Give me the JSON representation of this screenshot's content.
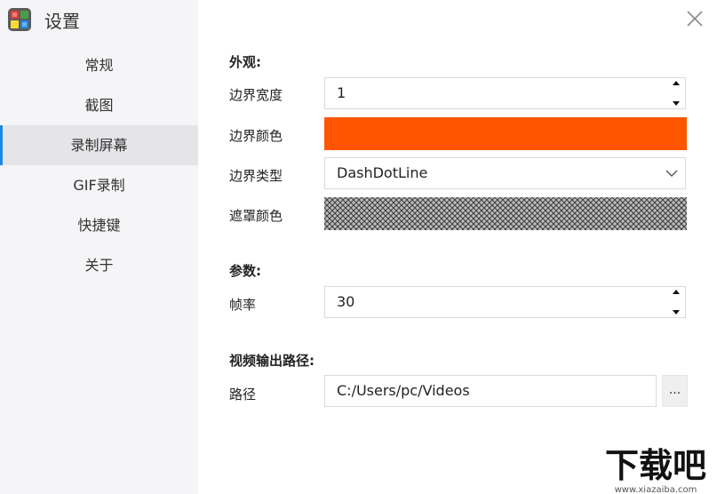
{
  "app": {
    "title": "设置"
  },
  "sidebar": {
    "items": [
      {
        "label": "常规",
        "active": false
      },
      {
        "label": "截图",
        "active": false
      },
      {
        "label": "录制屏幕",
        "active": true
      },
      {
        "label": "GIF录制",
        "active": false
      },
      {
        "label": "快捷键",
        "active": false
      },
      {
        "label": "关于",
        "active": false
      }
    ]
  },
  "appearance": {
    "title": "外观:",
    "border_width": {
      "label": "边界宽度",
      "value": "1"
    },
    "border_color": {
      "label": "边界颜色",
      "color": "#ff5500"
    },
    "border_type": {
      "label": "边界类型",
      "value": "DashDotLine"
    },
    "mask_color": {
      "label": "遮罩颜色",
      "pattern": "crosshatch-gray"
    }
  },
  "params": {
    "title": "参数:",
    "frame_rate": {
      "label": "帧率",
      "value": "30"
    }
  },
  "output": {
    "title": "视频输出路径:",
    "path": {
      "label": "路径",
      "value": "C:/Users/pc/Videos"
    },
    "browse_label": "..."
  },
  "watermark": {
    "text": "下载吧",
    "url": "www.xiazaiba.com"
  },
  "colors": {
    "accent": "#1e88e5",
    "border_color": "#ff5500",
    "sidebar_bg": "#f5f5f7"
  }
}
